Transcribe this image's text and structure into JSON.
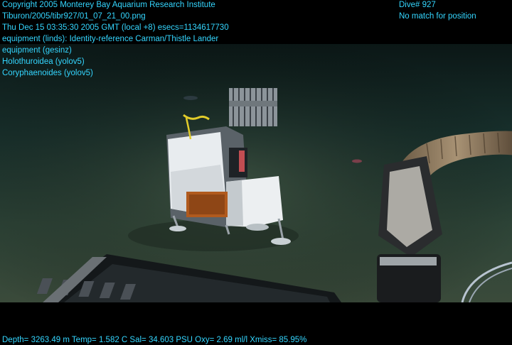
{
  "overlay": {
    "top_left": [
      "Copyright 2005 Monterey Bay Aquarium Research Institute",
      "Tiburon/2005/tibr927/01_07_21_00.png",
      "Thu Dec 15 03:35:30 2005 GMT (local +8)  esecs=1134617730",
      "equipment (linds): Identity-reference Carman/Thistle Lander",
      "equipment (gesinz)",
      "Holothuroidea (yolov5)",
      "Coryphaenoides (yolov5)"
    ],
    "top_right": [
      "Dive# 927",
      "No match for position"
    ],
    "bottom": "Depth= 3263.49 m  Temp= 1.582 C  Sal= 34.603 PSU  Oxy= 2.69 ml/l  Xmiss= 85.95%"
  },
  "colors": {
    "overlay_text": "#34d6ff",
    "water_dark": "#0e1e1e",
    "seafloor": "#3c4a3a"
  }
}
